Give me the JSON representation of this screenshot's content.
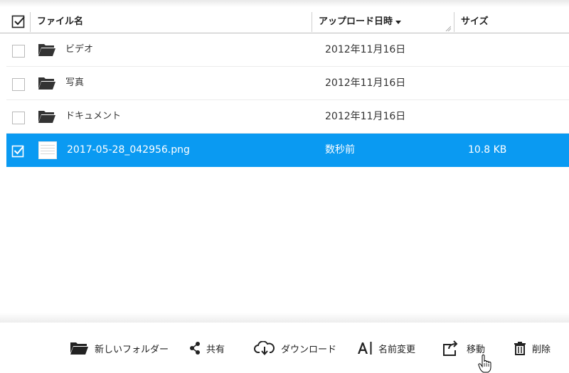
{
  "header": {
    "name_label": "ファイル名",
    "date_label": "アップロード日時",
    "size_label": "サイズ",
    "sort_column": "date",
    "sort_direction": "descending"
  },
  "files": [
    {
      "name": "ビデオ",
      "date": "2012年11月16日",
      "size": "",
      "type": "folder",
      "selected": false
    },
    {
      "name": "写真",
      "date": "2012年11月16日",
      "size": "",
      "type": "folder",
      "selected": false
    },
    {
      "name": "ドキュメント",
      "date": "2012年11月16日",
      "size": "",
      "type": "folder",
      "selected": false
    },
    {
      "name": "2017-05-28_042956.png",
      "date": "数秒前",
      "size": "10.8 KB",
      "type": "image",
      "selected": true
    }
  ],
  "toolbar": {
    "new_folder": "新しいフォルダー",
    "share": "共有",
    "download": "ダウンロード",
    "rename": "名前変更",
    "move": "移動",
    "delete": "削除"
  },
  "colors": {
    "selection": "#0a9af2",
    "icon": "#222222"
  }
}
